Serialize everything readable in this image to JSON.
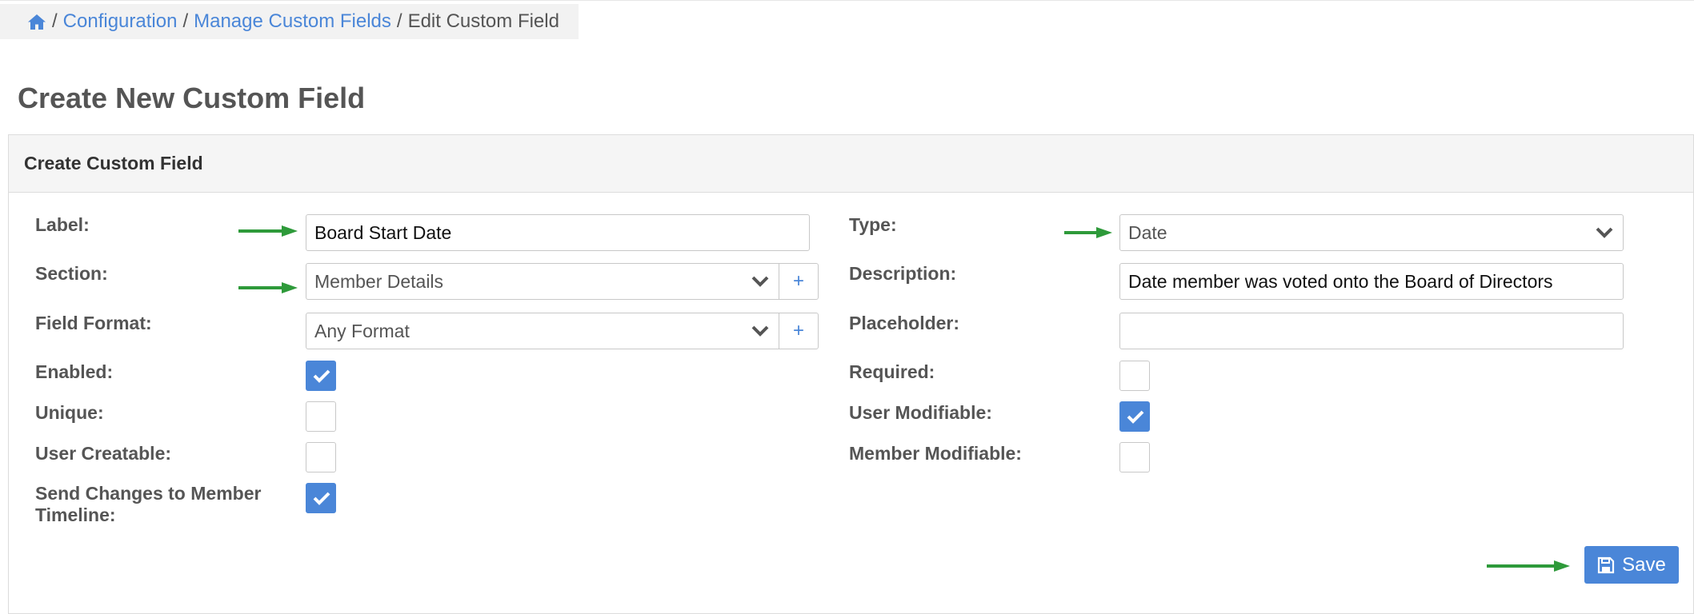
{
  "breadcrumb": {
    "home_icon": "home-icon",
    "items": [
      "Configuration",
      "Manage Custom Fields",
      "Edit Custom Field"
    ],
    "separator": "/"
  },
  "page_title": "Create New Custom Field",
  "panel_title": "Create Custom Field",
  "left": {
    "label": {
      "label": "Label:",
      "value": "Board Start Date"
    },
    "section": {
      "label": "Section:",
      "value": "Member Details",
      "add": "+"
    },
    "field_format": {
      "label": "Field Format:",
      "value": "Any Format",
      "add": "+"
    },
    "enabled": {
      "label": "Enabled:",
      "checked": true
    },
    "unique": {
      "label": "Unique:",
      "checked": false
    },
    "user_creatable": {
      "label": "User Creatable:",
      "checked": false
    },
    "send_changes": {
      "label_line1": "Send Changes to Member",
      "label_line2": "Timeline:",
      "checked": true
    }
  },
  "right": {
    "type": {
      "label": "Type:",
      "value": "Date"
    },
    "description": {
      "label": "Description:",
      "value": "Date member was voted onto the Board of Directors"
    },
    "placeholder": {
      "label": "Placeholder:",
      "value": ""
    },
    "required": {
      "label": "Required:",
      "checked": false
    },
    "user_modifiable": {
      "label": "User Modifiable:",
      "checked": true
    },
    "member_modifiable": {
      "label": "Member Modifiable:",
      "checked": false
    }
  },
  "save_button": {
    "label": "Save",
    "icon": "floppy-disk-icon"
  },
  "colors": {
    "accent": "#4a86d8",
    "annotation_arrow": "#2e9a3a"
  }
}
